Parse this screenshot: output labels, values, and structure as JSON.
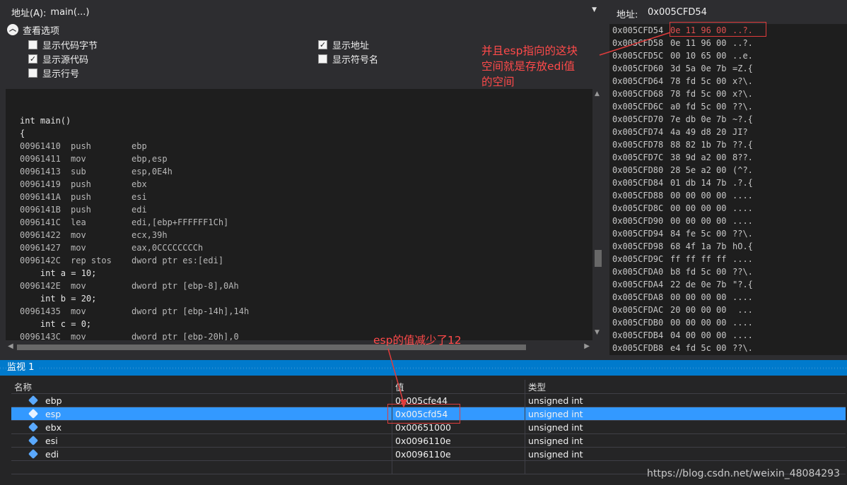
{
  "disasm": {
    "address_label": "地址(A):",
    "address_value": "main(...)",
    "view_options": {
      "header": "查看选项",
      "options": [
        {
          "label": "显示代码字节",
          "checked": false
        },
        {
          "label": "显示源代码",
          "checked": true
        },
        {
          "label": "显示行号",
          "checked": false
        },
        {
          "label": "显示地址",
          "checked": true
        },
        {
          "label": "显示符号名",
          "checked": false
        }
      ]
    },
    "lines": [
      {
        "kind": "src",
        "text": "int main()"
      },
      {
        "kind": "src",
        "text": "{"
      },
      {
        "kind": "asm",
        "addr": "00961410",
        "op": "push",
        "arg": "ebp"
      },
      {
        "kind": "asm",
        "addr": "00961411",
        "op": "mov",
        "arg": "ebp,esp"
      },
      {
        "kind": "asm",
        "addr": "00961413",
        "op": "sub",
        "arg": "esp,0E4h"
      },
      {
        "kind": "asm",
        "addr": "00961419",
        "op": "push",
        "arg": "ebx"
      },
      {
        "kind": "asm",
        "addr": "0096141A",
        "op": "push",
        "arg": "esi"
      },
      {
        "kind": "asm",
        "addr": "0096141B",
        "op": "push",
        "arg": "edi"
      },
      {
        "kind": "asm",
        "addr": "0096141C",
        "op": "lea",
        "arg": "edi,[ebp+FFFFFF1Ch]",
        "current": true
      },
      {
        "kind": "asm",
        "addr": "00961422",
        "op": "mov",
        "arg": "ecx,39h"
      },
      {
        "kind": "asm",
        "addr": "00961427",
        "op": "mov",
        "arg": "eax,0CCCCCCCCh"
      },
      {
        "kind": "asm",
        "addr": "0096142C",
        "op": "rep stos",
        "arg": "dword ptr es:[edi]"
      },
      {
        "kind": "src",
        "text": "    int a = 10;"
      },
      {
        "kind": "asm",
        "addr": "0096142E",
        "op": "mov",
        "arg": "dword ptr [ebp-8],0Ah"
      },
      {
        "kind": "src",
        "text": "    int b = 20;"
      },
      {
        "kind": "asm",
        "addr": "00961435",
        "op": "mov",
        "arg": "dword ptr [ebp-14h],14h"
      },
      {
        "kind": "src",
        "text": "    int c = 0;"
      },
      {
        "kind": "asm",
        "addr": "0096143C",
        "op": "mov",
        "arg": "dword ptr [ebp-20h],0"
      }
    ]
  },
  "memory": {
    "address_label": "地址:",
    "address_value": "0x005CFD54",
    "rows": [
      {
        "addr": "0x005CFD54",
        "bytes": "0e 11 96 00",
        "chars": "..?."
      },
      {
        "addr": "0x005CFD58",
        "bytes": "0e 11 96 00",
        "chars": "..?."
      },
      {
        "addr": "0x005CFD5C",
        "bytes": "00 10 65 00",
        "chars": "..e."
      },
      {
        "addr": "0x005CFD60",
        "bytes": "3d 5a 0e 7b",
        "chars": "=Z.{"
      },
      {
        "addr": "0x005CFD64",
        "bytes": "78 fd 5c 00",
        "chars": "x?\\."
      },
      {
        "addr": "0x005CFD68",
        "bytes": "78 fd 5c 00",
        "chars": "x?\\."
      },
      {
        "addr": "0x005CFD6C",
        "bytes": "a0 fd 5c 00",
        "chars": "??\\."
      },
      {
        "addr": "0x005CFD70",
        "bytes": "7e db 0e 7b",
        "chars": "~?.{"
      },
      {
        "addr": "0x005CFD74",
        "bytes": "4a 49 d8 20",
        "chars": "JI? "
      },
      {
        "addr": "0x005CFD78",
        "bytes": "88 82 1b 7b",
        "chars": "??.{"
      },
      {
        "addr": "0x005CFD7C",
        "bytes": "38 9d a2 00",
        "chars": "8??."
      },
      {
        "addr": "0x005CFD80",
        "bytes": "28 5e a2 00",
        "chars": "(^?."
      },
      {
        "addr": "0x005CFD84",
        "bytes": "01 db 14 7b",
        "chars": ".?.{"
      },
      {
        "addr": "0x005CFD88",
        "bytes": "00 00 00 00",
        "chars": "...."
      },
      {
        "addr": "0x005CFD8C",
        "bytes": "00 00 00 00",
        "chars": "...."
      },
      {
        "addr": "0x005CFD90",
        "bytes": "00 00 00 00",
        "chars": "...."
      },
      {
        "addr": "0x005CFD94",
        "bytes": "84 fe 5c 00",
        "chars": "??\\."
      },
      {
        "addr": "0x005CFD98",
        "bytes": "68 4f 1a 7b",
        "chars": "hO.{"
      },
      {
        "addr": "0x005CFD9C",
        "bytes": "ff ff ff ff",
        "chars": "...."
      },
      {
        "addr": "0x005CFDA0",
        "bytes": "b8 fd 5c 00",
        "chars": "??\\."
      },
      {
        "addr": "0x005CFDA4",
        "bytes": "22 de 0e 7b",
        "chars": "\"?.{"
      },
      {
        "addr": "0x005CFDA8",
        "bytes": "00 00 00 00",
        "chars": "...."
      },
      {
        "addr": "0x005CFDAC",
        "bytes": "20 00 00 00",
        "chars": " ..."
      },
      {
        "addr": "0x005CFDB0",
        "bytes": "00 00 00 00",
        "chars": "...."
      },
      {
        "addr": "0x005CFDB4",
        "bytes": "04 00 00 00",
        "chars": "...."
      },
      {
        "addr": "0x005CFDB8",
        "bytes": "e4 fd 5c 00",
        "chars": "??\\."
      }
    ]
  },
  "watch": {
    "title": "监视 1",
    "columns": [
      "名称",
      "值",
      "类型"
    ],
    "rows": [
      {
        "name": "ebp",
        "value": "0x005cfe44",
        "type": "unsigned int",
        "selected": false
      },
      {
        "name": "esp",
        "value": "0x005cfd54",
        "type": "unsigned int",
        "selected": true
      },
      {
        "name": "ebx",
        "value": "0x00651000",
        "type": "unsigned int",
        "selected": false
      },
      {
        "name": "esi",
        "value": "0x0096110e",
        "type": "unsigned int",
        "selected": false
      },
      {
        "name": "edi",
        "value": "0x0096110e",
        "type": "unsigned int",
        "selected": false
      }
    ]
  },
  "annotations": {
    "note1": [
      "并且esp指向的这块",
      "空间就是存放edi值",
      "的空间"
    ],
    "note2": "esp的值减少了12",
    "watermark": "https://blog.csdn.net/weixin_48084293"
  },
  "colors": {
    "accent": "#007acc",
    "selection": "#3399ff",
    "annotation": "#e03c3c"
  }
}
